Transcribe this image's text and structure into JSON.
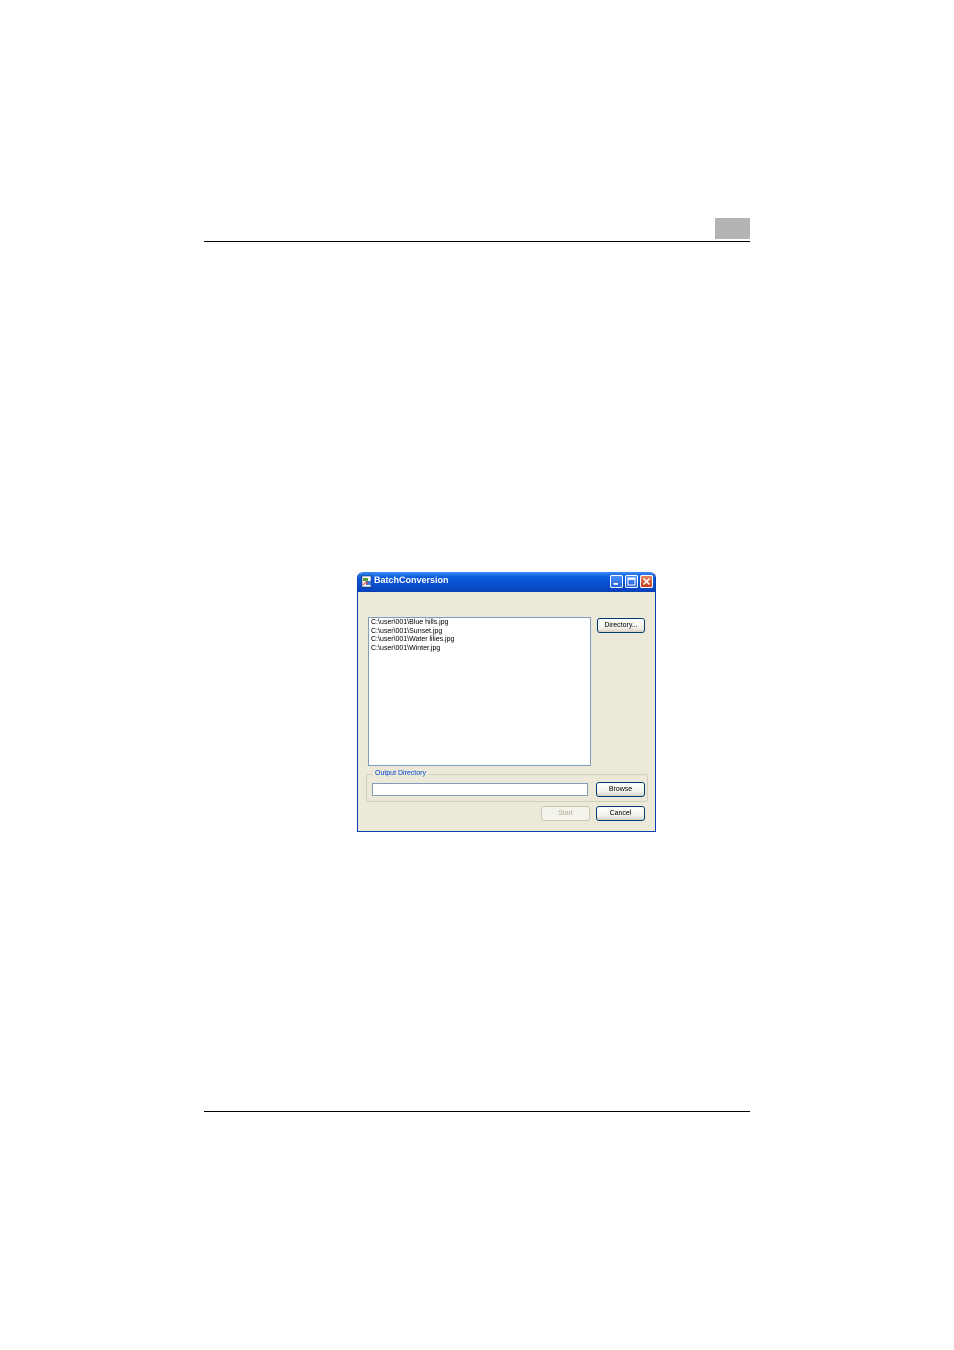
{
  "window": {
    "title": "BatchConversion",
    "file_list": [
      "C:\\user\\001\\Blue hills.jpg",
      "C:\\user\\001\\Sunset.jpg",
      "C:\\user\\001\\Water lilies.jpg",
      "C:\\user\\001\\Winter.jpg"
    ],
    "directory_button": "Directory...",
    "output_group_label": "Output Directory",
    "output_value": "",
    "browse_button": "Browse",
    "start_button": "Start",
    "cancel_button": "Cancel"
  },
  "icons": {
    "app": "batch-conversion-app-icon",
    "minimize": "minimize-icon",
    "maximize": "maximize-icon",
    "close": "close-icon"
  },
  "colors": {
    "titlebar": "#0a4fd0",
    "dialog_bg": "#ece9d8",
    "group_label": "#0046d5",
    "close_button": "#c2391b"
  }
}
